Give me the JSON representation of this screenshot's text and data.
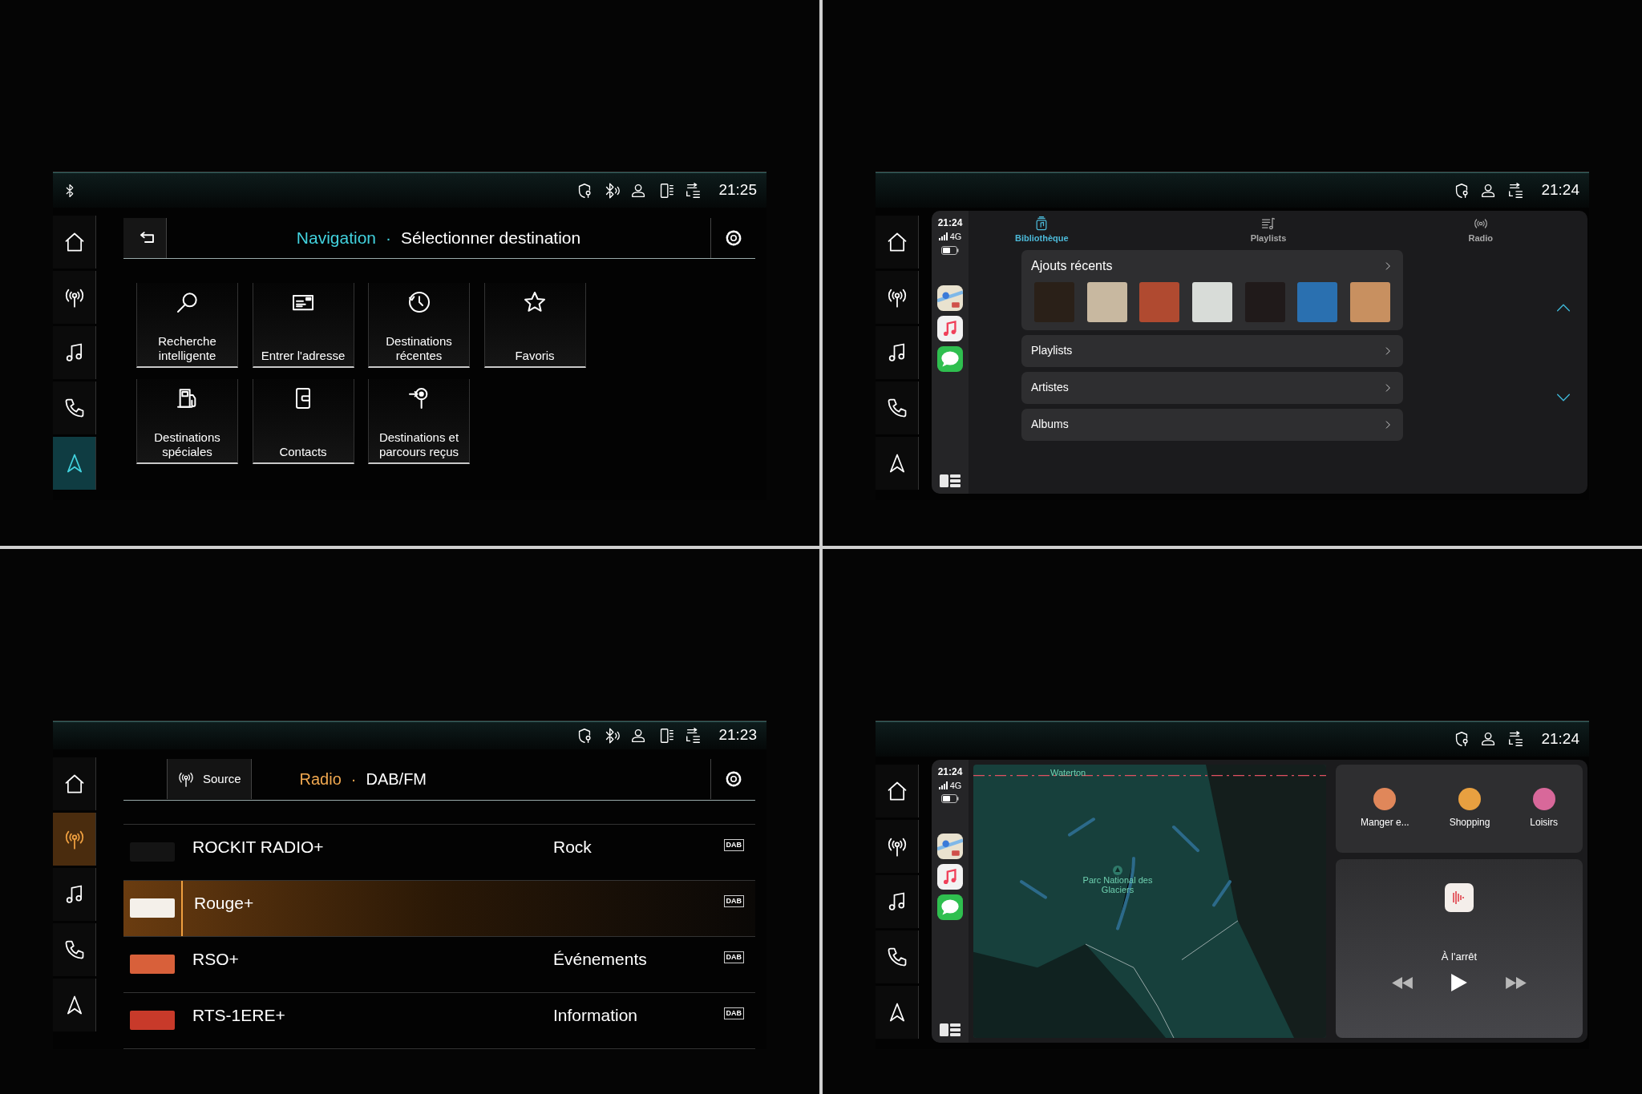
{
  "screens": [
    {
      "kind": "navigation",
      "status_bar": {
        "left_icons": [
          {
            "kind": "bluetooth"
          }
        ],
        "icons": [
          {
            "kind": "shield-pin"
          },
          {
            "kind": "bluetooth-audio"
          },
          {
            "kind": "user"
          },
          {
            "kind": "phone-device"
          },
          {
            "kind": "lte"
          }
        ],
        "time": "21:25"
      },
      "rail": [
        {
          "kind": "home",
          "selected": false
        },
        {
          "kind": "radio",
          "selected": false
        },
        {
          "kind": "music",
          "selected": false
        },
        {
          "kind": "phone",
          "selected": false
        },
        {
          "kind": "navigation",
          "selected": true
        }
      ],
      "header": {
        "title": "Navigation",
        "separator": "·",
        "subtitle": "Sélectionner destination"
      },
      "tiles": [
        {
          "kind": "search",
          "label": "Recherche intelligente"
        },
        {
          "kind": "address",
          "label": "Entrer l'adresse"
        },
        {
          "kind": "recent",
          "label": "Destinations récentes"
        },
        {
          "kind": "star",
          "label": "Favoris"
        },
        {
          "kind": "fuel",
          "label": "Destinations spéciales"
        },
        {
          "kind": "contacts",
          "label": "Contacts"
        },
        {
          "kind": "received",
          "label": "Destinations et parcours reçus"
        }
      ]
    },
    {
      "kind": "music",
      "status_bar": {
        "icons": [
          {
            "kind": "shield-pin"
          },
          {
            "kind": "user"
          },
          {
            "kind": "lte"
          }
        ],
        "time": "21:24"
      },
      "rail": [
        {
          "kind": "home",
          "selected": false
        },
        {
          "kind": "radio",
          "selected": false
        },
        {
          "kind": "music",
          "selected": false
        },
        {
          "kind": "phone",
          "selected": false
        },
        {
          "kind": "navigation",
          "selected": false
        }
      ],
      "dock": {
        "time": "21:24",
        "network": "4G",
        "apps": [
          {
            "kind": "maps"
          },
          {
            "kind": "music"
          },
          {
            "kind": "messages"
          }
        ]
      },
      "tabs": [
        {
          "kind": "library",
          "label": "Bibliothèque",
          "selected": true
        },
        {
          "kind": "playlists",
          "label": "Playlists",
          "selected": false
        },
        {
          "kind": "radio",
          "label": "Radio",
          "selected": false
        }
      ],
      "sections": [
        {
          "label": "Ajouts récents",
          "covers": [
            {
              "color": "#2a2018"
            },
            {
              "color": "#c8b8a0"
            },
            {
              "color": "#b04a30"
            },
            {
              "color": "#d8dcd8"
            },
            {
              "color": "#201a1a"
            },
            {
              "color": "#2a70b0"
            },
            {
              "color": "#c89060"
            }
          ]
        },
        {
          "label": "Playlists"
        },
        {
          "label": "Artistes"
        },
        {
          "label": "Albums"
        }
      ]
    },
    {
      "kind": "radio",
      "status_bar": {
        "icons": [
          {
            "kind": "shield-pin"
          },
          {
            "kind": "bluetooth-audio"
          },
          {
            "kind": "user"
          },
          {
            "kind": "phone-device"
          },
          {
            "kind": "lte"
          }
        ],
        "time": "21:23"
      },
      "rail": [
        {
          "kind": "home",
          "selected": false
        },
        {
          "kind": "radio",
          "selected": true
        },
        {
          "kind": "music",
          "selected": false
        },
        {
          "kind": "phone",
          "selected": false
        },
        {
          "kind": "navigation",
          "selected": false
        }
      ],
      "header": {
        "source": "Source",
        "title": "Radio",
        "separator": "·",
        "subtitle": "DAB/FM"
      },
      "stations": [
        {
          "name": "ROCKIT RADIO+",
          "genre": "Rock",
          "badge": "DAB",
          "selected": false
        },
        {
          "name": "Rouge+",
          "badge": "DAB",
          "selected": true
        },
        {
          "name": "RSO+",
          "genre": "Événements",
          "badge": "DAB",
          "selected": false
        },
        {
          "name": "RTS-1ERE+",
          "genre": "Information",
          "badge": "DAB",
          "selected": false
        }
      ]
    },
    {
      "kind": "map",
      "status_bar": {
        "icons": [
          {
            "kind": "shield-pin"
          },
          {
            "kind": "user"
          },
          {
            "kind": "lte"
          }
        ],
        "time": "21:24"
      },
      "rail": [
        {
          "kind": "home",
          "selected": false
        },
        {
          "kind": "radio",
          "selected": false
        },
        {
          "kind": "music",
          "selected": false
        },
        {
          "kind": "phone",
          "selected": false
        },
        {
          "kind": "navigation",
          "selected": false
        }
      ],
      "dock": {
        "time": "21:24",
        "network": "4G",
        "apps": [
          {
            "kind": "maps"
          },
          {
            "kind": "music"
          },
          {
            "kind": "messages"
          }
        ]
      },
      "map": {
        "labels": [
          "Waterton",
          "Parc National des Glaciers"
        ]
      },
      "categories": [
        {
          "label": "Manger e...",
          "color": "#e0875a"
        },
        {
          "label": "Shopping",
          "color": "#e8a040"
        },
        {
          "label": "Loisirs",
          "color": "#d8689a"
        }
      ],
      "now_playing": {
        "status": "À l'arrêt"
      }
    }
  ]
}
